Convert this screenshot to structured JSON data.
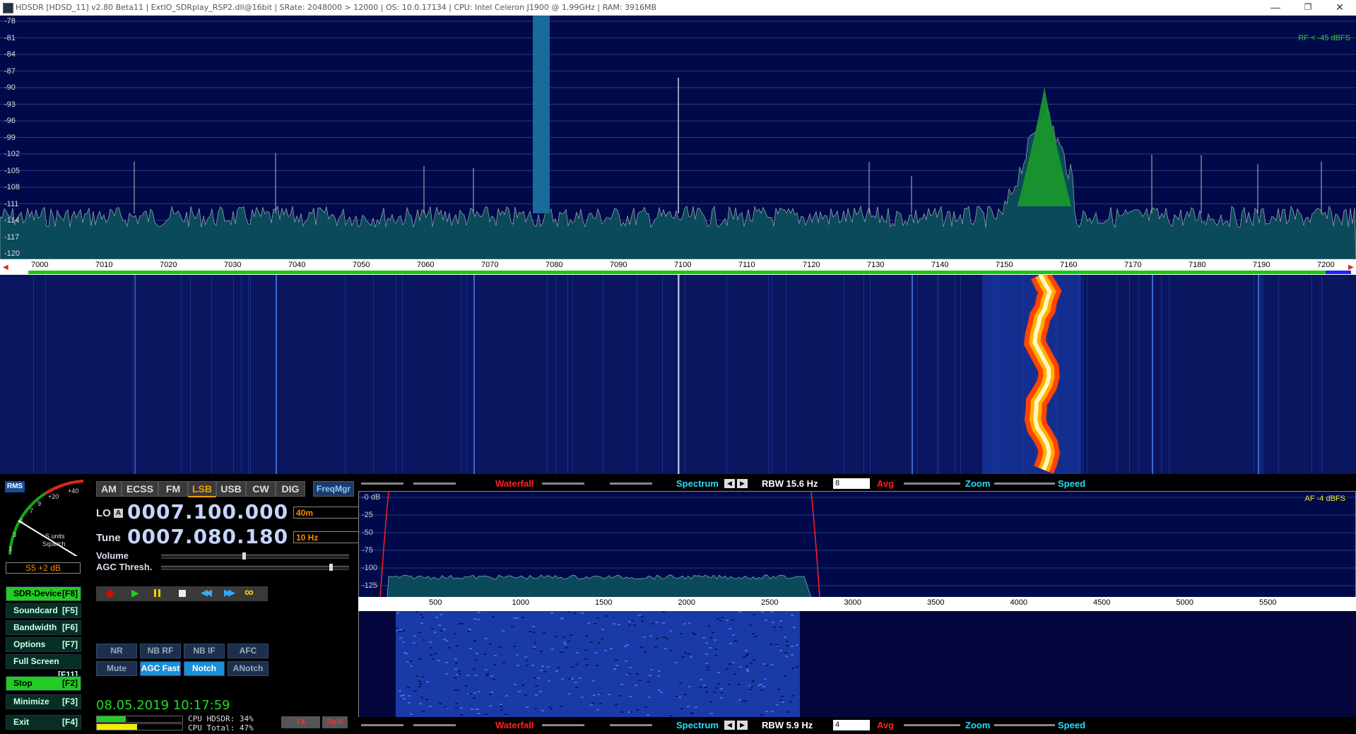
{
  "window": {
    "title": "HDSDR  [HDSD_11]  v2.80 Beta11  |  ExtIO_SDRplay_RSP2.dll@16bit  |  SRate: 2048000 > 12000  |  OS: 10.0.17134   |  CPU: Intel Celeron  J1900  @ 1.99GHz  |  RAM: 3916MB",
    "minimize": "—",
    "restore": "❐",
    "close": "✕"
  },
  "spectrum": {
    "rf_label": "RF < -45 dBFS",
    "y_labels": [
      "-78",
      "-81",
      "-84",
      "-87",
      "-90",
      "-93",
      "-96",
      "-99",
      "-102",
      "-105",
      "-108",
      "-111",
      "-114",
      "-117",
      "-120"
    ],
    "freq_labels": [
      "7000",
      "7010",
      "7020",
      "7030",
      "7040",
      "7050",
      "7060",
      "7070",
      "7080",
      "7090",
      "7100",
      "7110",
      "7120",
      "7130",
      "7140",
      "7150",
      "7160",
      "7170",
      "7180",
      "7190",
      "7200"
    ]
  },
  "modes": [
    "AM",
    "ECSS",
    "FM",
    "LSB",
    "USB",
    "CW",
    "DIG"
  ],
  "active_mode": "LSB",
  "freqmgr_label": "FreqMgr",
  "smeter": {
    "rms_label": "RMS",
    "scale": [
      "1",
      "3",
      "5",
      "7",
      "9",
      "+20",
      "+40"
    ],
    "units_label": "S units",
    "squelch_label": "Squelch",
    "reading": "S5 +2 dB"
  },
  "lo": {
    "label": "LO",
    "badge": "A",
    "value": "0007.100.000",
    "band": "40m"
  },
  "tune": {
    "label": "Tune",
    "value": "0007.080.180",
    "step": "10 Hz"
  },
  "volume_label": "Volume",
  "agc_label": "AGC Thresh.",
  "side_buttons": [
    {
      "label": "SDR-Device",
      "key": "[F8]"
    },
    {
      "label": "Soundcard",
      "key": "[F5]"
    },
    {
      "label": "Bandwidth",
      "key": "[F6]"
    },
    {
      "label": "Options",
      "key": "[F7]"
    },
    {
      "label": "Full Screen",
      "key": "[F11]"
    },
    {
      "label": "Stop",
      "key": "[F2]"
    },
    {
      "label": "Minimize",
      "key": "[F3]"
    },
    {
      "label": "Exit",
      "key": "[F4]"
    }
  ],
  "transport": {
    "record": "record",
    "play": "play",
    "pause": "pause",
    "stop": "stop",
    "rewind": "rewind",
    "forward": "fast-forward",
    "loop": "loop"
  },
  "dsp_buttons": [
    "NR",
    "NB RF",
    "NB IF",
    "AFC",
    "Mute",
    "AGC Fast",
    "Notch",
    "ANotch"
  ],
  "datetime": "08.05.2019 10:17:59",
  "cpu": {
    "hdsdr": "CPU HDSDR: 34%",
    "total": "CPU Total: 47%",
    "hdsdr_pct": 34,
    "total_pct": 47
  },
  "tx_label": "TX",
  "split_label": "Split",
  "toolbar_top": {
    "waterfall": "Waterfall",
    "spectrum": "Spectrum",
    "rbw": "RBW 15.6 Hz",
    "avg_value": "8",
    "avg": "Avg",
    "zoom": "Zoom",
    "speed": "Speed"
  },
  "toolbar_bottom": {
    "waterfall": "Waterfall",
    "spectrum": "Spectrum",
    "rbw": "RBW  5.9 Hz",
    "avg_value": "4",
    "avg": "Avg",
    "zoom": "Zoom",
    "speed": "Speed"
  },
  "audio": {
    "af_label": "AF  -4 dBFS",
    "y_labels": [
      "-0 dB",
      "-25",
      "-50",
      "-75",
      "-100",
      "-125"
    ],
    "freq_labels": [
      "500",
      "1000",
      "1500",
      "2000",
      "2500",
      "3000",
      "3500",
      "4000",
      "4500",
      "5000",
      "5500"
    ]
  },
  "colors": {
    "accent_green": "#22cc22",
    "mode_active": "#f0a000",
    "marker_red": "#ff2020",
    "spectrum_fill": "#0a3a5a"
  }
}
